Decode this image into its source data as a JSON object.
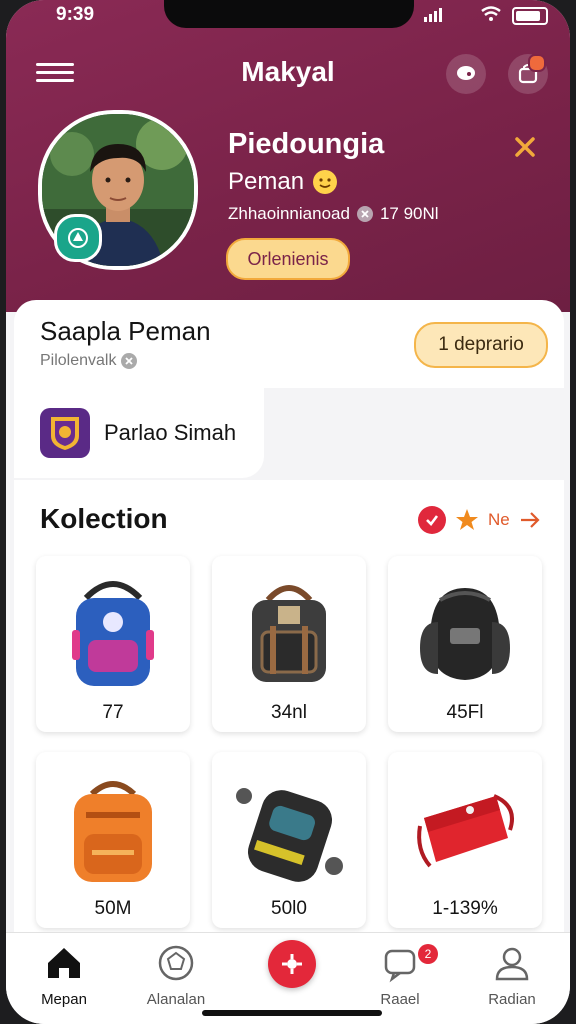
{
  "status": {
    "time": "9:39"
  },
  "header": {
    "title": "Makyal"
  },
  "profile": {
    "name": "Piedoungia",
    "role": "Peman",
    "meta": "Zhhaoinnianoad",
    "meta_count": "17 90Nl",
    "pill_label": "Orlenienis"
  },
  "summary": {
    "title": "Saapla Peman",
    "subtitle": "Pilolenvalk",
    "action_label": "1 deprario"
  },
  "team": {
    "name": "Parlao Simah"
  },
  "collection": {
    "title": "Kolection",
    "more_label": "Ne",
    "items": [
      {
        "price": "77",
        "icon": "blue-backpack-icon"
      },
      {
        "price": "34nl",
        "icon": "dark-backpack-icon"
      },
      {
        "price": "45Fl",
        "icon": "helmet-bag-icon"
      },
      {
        "price": "50M",
        "icon": "orange-backpack-icon"
      },
      {
        "price": "50l0",
        "icon": "gear-case-icon"
      },
      {
        "price": "1-139%",
        "icon": "red-sling-bag-icon"
      }
    ]
  },
  "tabs": [
    {
      "label": "Mepan",
      "icon": "home-icon"
    },
    {
      "label": "Alanalan",
      "icon": "ball-icon"
    },
    {
      "label": "",
      "icon": "center-action-icon"
    },
    {
      "label": "Raael",
      "icon": "chat-icon",
      "badge": "2"
    },
    {
      "label": "Radian",
      "icon": "user-icon"
    }
  ],
  "colors": {
    "brand": "#7a2349",
    "accent": "#f2a93b",
    "alert": "#e3283a"
  }
}
